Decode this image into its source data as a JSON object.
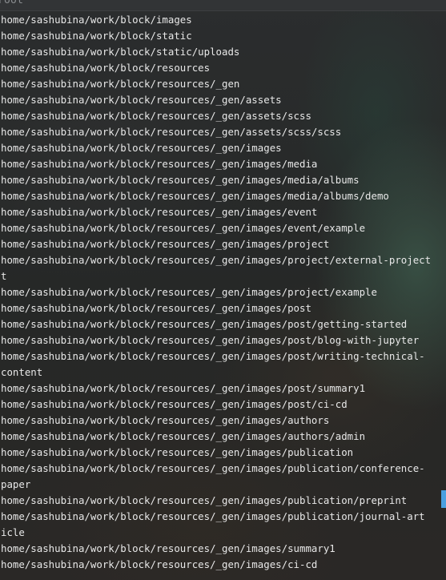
{
  "header": {
    "text": "root"
  },
  "lines": [
    "home/sashubina/work/block/images",
    "home/sashubina/work/block/static",
    "home/sashubina/work/block/static/uploads",
    "home/sashubina/work/block/resources",
    "home/sashubina/work/block/resources/_gen",
    "home/sashubina/work/block/resources/_gen/assets",
    "home/sashubina/work/block/resources/_gen/assets/scss",
    "home/sashubina/work/block/resources/_gen/assets/scss/scss",
    "home/sashubina/work/block/resources/_gen/images",
    "home/sashubina/work/block/resources/_gen/images/media",
    "home/sashubina/work/block/resources/_gen/images/media/albums",
    "home/sashubina/work/block/resources/_gen/images/media/albums/demo",
    "home/sashubina/work/block/resources/_gen/images/event",
    "home/sashubina/work/block/resources/_gen/images/event/example",
    "home/sashubina/work/block/resources/_gen/images/project",
    "home/sashubina/work/block/resources/_gen/images/project/external-project",
    "t",
    "home/sashubina/work/block/resources/_gen/images/project/example",
    "home/sashubina/work/block/resources/_gen/images/post",
    "home/sashubina/work/block/resources/_gen/images/post/getting-started",
    "home/sashubina/work/block/resources/_gen/images/post/blog-with-jupyter",
    "home/sashubina/work/block/resources/_gen/images/post/writing-technical-",
    "content",
    "home/sashubina/work/block/resources/_gen/images/post/summary1",
    "home/sashubina/work/block/resources/_gen/images/post/ci-cd",
    "home/sashubina/work/block/resources/_gen/images/authors",
    "home/sashubina/work/block/resources/_gen/images/authors/admin",
    "home/sashubina/work/block/resources/_gen/images/publication",
    "home/sashubina/work/block/resources/_gen/images/publication/conference-",
    "paper",
    "home/sashubina/work/block/resources/_gen/images/publication/preprint",
    "home/sashubina/work/block/resources/_gen/images/publication/journal-art",
    "icle",
    "home/sashubina/work/block/resources/_gen/images/summary1",
    "home/sashubina/work/block/resources/_gen/images/ci-cd"
  ],
  "colors": {
    "background": "#2a2b2b",
    "text": "#e8e8e8",
    "cursor": "#4a9fe0"
  }
}
